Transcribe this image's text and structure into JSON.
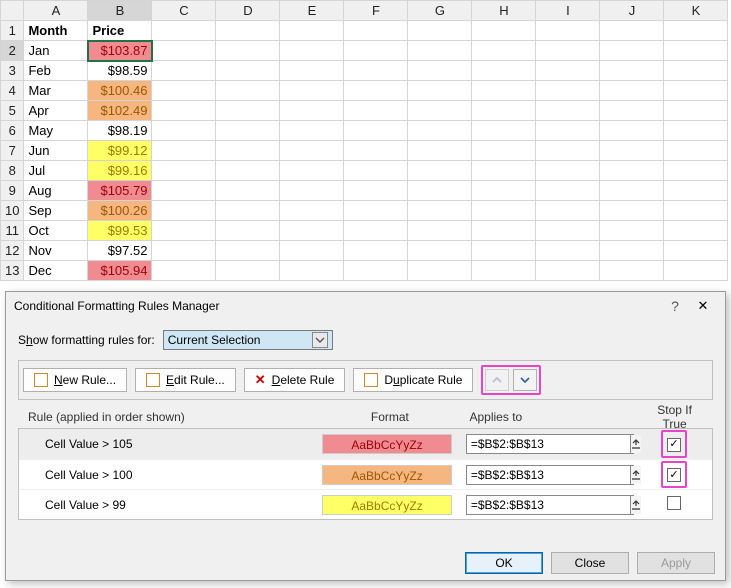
{
  "sheet": {
    "columns": [
      "A",
      "B",
      "C",
      "D",
      "E",
      "F",
      "G",
      "H",
      "I",
      "J",
      "K"
    ],
    "headers": {
      "A": "Month",
      "B": "Price"
    },
    "rows": [
      {
        "n": 1,
        "A": "Month",
        "B": "Price",
        "bold": true
      },
      {
        "n": 2,
        "A": "Jan",
        "B": "$103.87",
        "fill": "red",
        "active": true
      },
      {
        "n": 3,
        "A": "Feb",
        "B": "$98.59"
      },
      {
        "n": 4,
        "A": "Mar",
        "B": "$100.46",
        "fill": "orange"
      },
      {
        "n": 5,
        "A": "Apr",
        "B": "$102.49",
        "fill": "orange"
      },
      {
        "n": 6,
        "A": "May",
        "B": "$98.19"
      },
      {
        "n": 7,
        "A": "Jun",
        "B": "$99.12",
        "fill": "yellow"
      },
      {
        "n": 8,
        "A": "Jul",
        "B": "$99.16",
        "fill": "yellow"
      },
      {
        "n": 9,
        "A": "Aug",
        "B": "$105.79",
        "fill": "red"
      },
      {
        "n": 10,
        "A": "Sep",
        "B": "$100.26",
        "fill": "orange"
      },
      {
        "n": 11,
        "A": "Oct",
        "B": "$99.53",
        "fill": "yellow"
      },
      {
        "n": 12,
        "A": "Nov",
        "B": "$97.52"
      },
      {
        "n": 13,
        "A": "Dec",
        "B": "$105.94",
        "fill": "red"
      }
    ]
  },
  "dialog": {
    "title": "Conditional Formatting Rules Manager",
    "show_label_pre": "S",
    "show_label_hot": "h",
    "show_label_post": "ow formatting rules for:",
    "scope": "Current Selection",
    "buttons": {
      "new_pre": "",
      "new_hot": "N",
      "new_post": "ew Rule...",
      "edit_pre": "",
      "edit_hot": "E",
      "edit_post": "dit Rule...",
      "delete_pre": "",
      "delete_hot": "D",
      "delete_post": "elete Rule",
      "dup_pre": "D",
      "dup_hot": "u",
      "dup_post": "plicate Rule"
    },
    "headers": {
      "rule": "Rule (applied in order shown)",
      "format": "Format",
      "applies": "Applies to",
      "stop": "Stop If True"
    },
    "sample": "AaBbCcYyZz",
    "rules": [
      {
        "desc": "Cell Value > 105",
        "fmt": "red",
        "applies": "=$B$2:$B$13",
        "stop": true,
        "selected": true,
        "stopHighlight": true
      },
      {
        "desc": "Cell Value > 100",
        "fmt": "orange",
        "applies": "=$B$2:$B$13",
        "stop": true,
        "stopHighlight": true
      },
      {
        "desc": "Cell Value > 99",
        "fmt": "yellow",
        "applies": "=$B$2:$B$13",
        "stop": false
      }
    ],
    "footer": {
      "ok": "OK",
      "close": "Close",
      "apply": "Apply"
    }
  }
}
